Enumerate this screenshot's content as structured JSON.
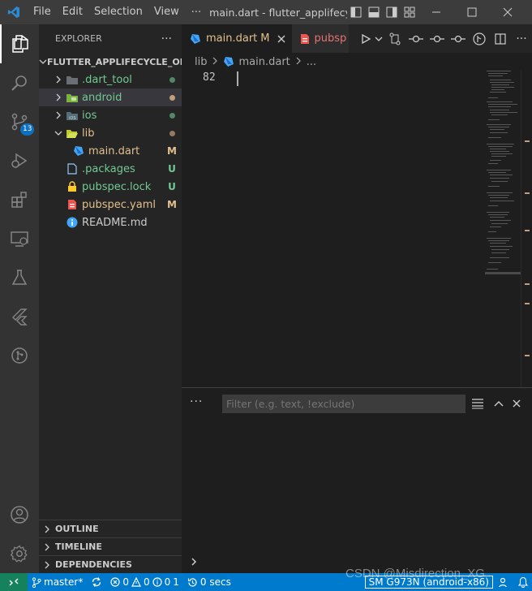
{
  "titlebar": {
    "app_icon": "vscode-logo-icon",
    "menu": [
      "File",
      "Edit",
      "Selection",
      "View"
    ],
    "more": "···",
    "window_title": "main.dart - flutter_applifecyc...",
    "colors": {
      "background": "#3c3c3c"
    }
  },
  "activitybar": {
    "items": [
      "explorer-icon",
      "search-icon",
      "source-control-icon",
      "run-debug-icon",
      "extensions-icon",
      "remote-explorer-icon",
      "testing-icon",
      "flutter-icon",
      "git-graph-icon"
    ],
    "scm_badge": "13",
    "bottom": [
      "account-icon",
      "manage-gear-icon"
    ]
  },
  "sidebar": {
    "title": "EXPLORER",
    "actions": "···",
    "project": "FLUTTER_APPLIFECYCLE_OR...",
    "tree": [
      {
        "name": ".dart_tool",
        "kind": "folder",
        "decoration": "dot",
        "color": "#73c991"
      },
      {
        "name": "android",
        "kind": "folder",
        "decoration": "dot",
        "color": "#73c991"
      },
      {
        "name": "ios",
        "kind": "folder",
        "decoration": "dot",
        "color": "#73c991"
      },
      {
        "name": "lib",
        "kind": "folder-open",
        "decoration": "dot",
        "color": "#e2c08d"
      },
      {
        "name": "main.dart",
        "kind": "dart",
        "decoration": "M",
        "color": "#e2c08d"
      },
      {
        "name": ".packages",
        "kind": "file",
        "decoration": "U",
        "color": "#73c991"
      },
      {
        "name": "pubspec.lock",
        "kind": "lock",
        "decoration": "U",
        "color": "#73c991"
      },
      {
        "name": "pubspec.yaml",
        "kind": "yaml",
        "decoration": "M",
        "color": "#e2c08d"
      },
      {
        "name": "README.md",
        "kind": "info",
        "decoration": "",
        "color": "#cccccc"
      }
    ],
    "sections": [
      "OUTLINE",
      "TIMELINE",
      "DEPENDENCIES"
    ]
  },
  "editor": {
    "tabs": [
      {
        "label": "main.dart",
        "status": "M",
        "active": true
      },
      {
        "label": "pubsp",
        "active": false
      }
    ],
    "breadcrumb": [
      "lib",
      "main.dart",
      "..."
    ],
    "line_number": "82",
    "actions": [
      "run-icon",
      "chevron-down-icon",
      "compare-icon",
      "dot-prev-icon",
      "dot-icon",
      "dot-next-icon",
      "flutter-inspector-icon",
      "split-editor-icon",
      "more-actions-icon"
    ]
  },
  "panel": {
    "more": "···",
    "filter_placeholder": "Filter (e.g. text, !exclude)",
    "prompt": "›"
  },
  "statusbar": {
    "branch": "master*",
    "errors": "0",
    "warnings": "0",
    "infos": "0",
    "info_extra": "1",
    "timer": "0 secs",
    "device": "SM G973N (android-x86)",
    "colors": {
      "background": "#007acc",
      "remote": "#16825d"
    }
  },
  "watermark": "CSDN @Misdirection_XG"
}
